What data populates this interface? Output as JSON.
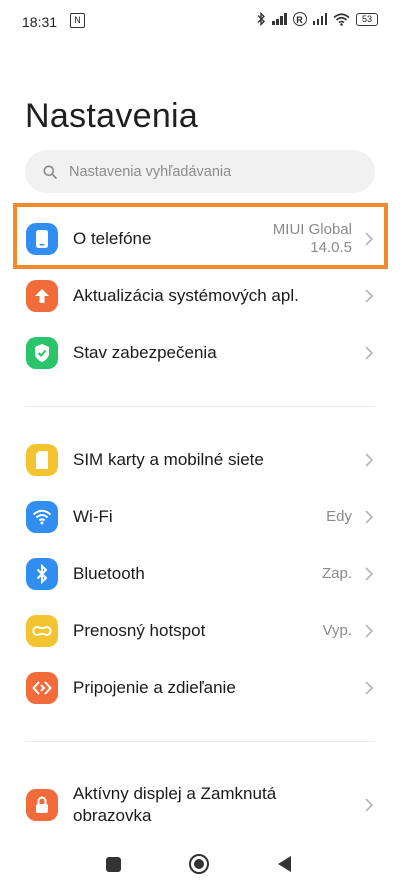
{
  "status_bar": {
    "time": "18:31",
    "nfc_glyph": "N",
    "roaming_glyph": "R",
    "battery": "53"
  },
  "page": {
    "title": "Nastavenia",
    "search_placeholder": "Nastavenia vyhľadávania"
  },
  "groups": [
    {
      "items": [
        {
          "label": "O telefóne",
          "value_line1": "MIUI Global",
          "value_line2": "14.0.5",
          "icon": "phone-icon",
          "color": "#2f8ef0"
        },
        {
          "label": "Aktualizácia systémových apl.",
          "value": "",
          "icon": "arrow-up-icon",
          "color": "#f26b3a"
        },
        {
          "label": "Stav zabezpečenia",
          "value": "",
          "icon": "shield-check-icon",
          "color": "#2cc46a"
        }
      ]
    },
    {
      "items": [
        {
          "label": "SIM karty a mobilné siete",
          "value": "",
          "icon": "sim-card-icon",
          "color": "#f4c430"
        },
        {
          "label": "Wi-Fi",
          "value": "Edy",
          "icon": "wifi-icon",
          "color": "#2f8ef0"
        },
        {
          "label": "Bluetooth",
          "value": "Zap.",
          "icon": "bluetooth-icon",
          "color": "#2f8ef0"
        },
        {
          "label": "Prenosný hotspot",
          "value": "Vyp.",
          "icon": "hotspot-icon",
          "color": "#f4c430"
        },
        {
          "label": "Pripojenie a zdieľanie",
          "value": "",
          "icon": "connection-sharing-icon",
          "color": "#f26b3a"
        }
      ]
    },
    {
      "items": [
        {
          "label_line1": "Aktívny displej a Zamknutá",
          "label_line2": "obrazovka",
          "value": "",
          "icon": "lock-icon",
          "color": "#f26b3a"
        }
      ]
    }
  ],
  "highlight_color": "#f08a2a"
}
